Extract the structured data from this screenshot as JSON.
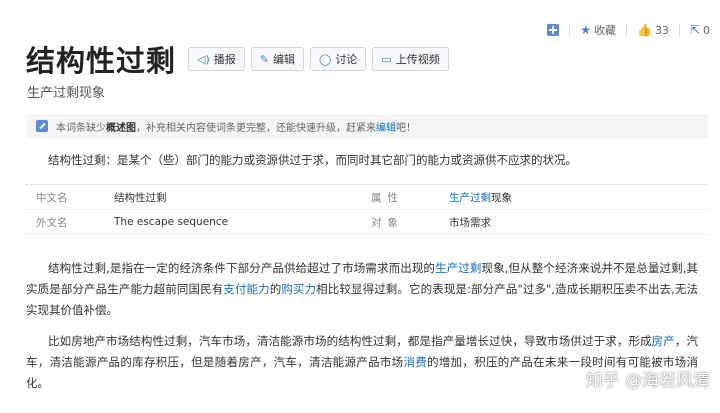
{
  "toolbar": {
    "collect_label": "收藏",
    "like_count": "33",
    "share_count": "0"
  },
  "entry": {
    "title": "结构性过剩",
    "buttons": [
      {
        "label": "播报",
        "icon": "speaker-icon"
      },
      {
        "label": "编辑",
        "icon": "pencil-icon"
      },
      {
        "label": "讨论",
        "icon": "chat-icon"
      },
      {
        "label": "上传视频",
        "icon": "video-icon"
      }
    ],
    "subtitle": "生产过剩现象"
  },
  "notice": {
    "pre": "本词条缺少",
    "bold": "概述图",
    "mid": "，补充相关内容使词条更完整，还能快速升级，赶紧来",
    "link": "编辑",
    "post": "吧！"
  },
  "summary": "结构性过剩：是某个（些）部门的能力或资源供过于求，而同时其它部门的能力或资源供不应求的状况。",
  "info": {
    "rows": [
      {
        "k1": "中文名",
        "v1": "结构性过剩",
        "k2": "属性",
        "v2_link": "生产过剩",
        "v2_text": "现象"
      },
      {
        "k1": "外文名",
        "v1": "The escape sequence",
        "k2": "对象",
        "v2_link": "",
        "v2_text": "市场需求"
      }
    ]
  },
  "paragraphs": {
    "p1": {
      "a": "结构性过剩,是指在一定的经济条件下部分产品供给超过了市场需求而出现的",
      "l1": "生产过剩",
      "b": "现象,但从整个经济来说并不是总量过剩,其实质是部分产品生产能力超前同国民有",
      "l2": "支付能力",
      "c": "的",
      "l3": "购买力",
      "d": "相比较显得过剩。它的表现是:部分产品\"过多\",造成长期积压卖不出去,无法实现其价值补偿。"
    },
    "p2": {
      "a": "比如房地产市场结构性过剩，汽车市场，清洁能源市场的结构性过剩，都是指产量增长过快，导致市场供过于求，形成",
      "l1": "房产",
      "b": "，汽车，清洁能源产品的库存积压，但是随着房产，汽车，清洁能源产品市场",
      "l2": "消费",
      "c": "的增加，积压的产品在未来一段时间有可能被市场消化。"
    }
  },
  "watermark": "知乎 @海若风清"
}
